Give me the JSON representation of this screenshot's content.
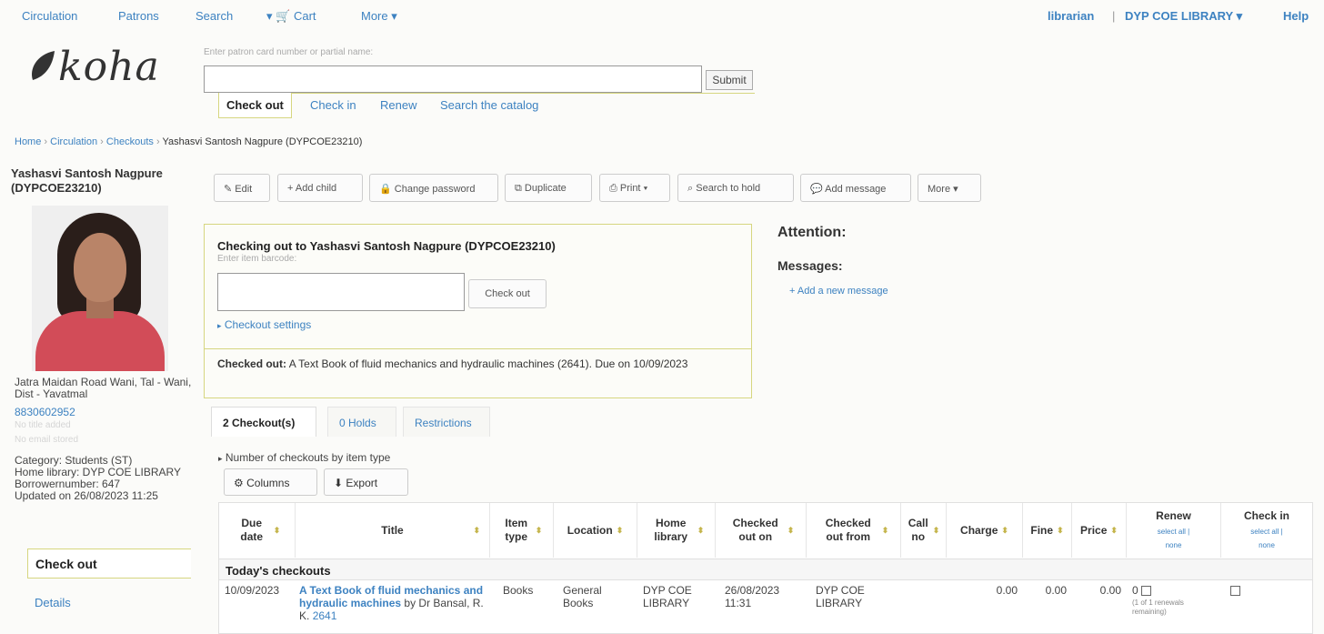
{
  "nav": {
    "circulation": "Circulation",
    "patrons": "Patrons",
    "search": "Search",
    "cart": "Cart",
    "more": "More",
    "user": "librarian",
    "separator": "|",
    "library": "DYP COE LIBRARY",
    "help": "Help"
  },
  "logo": {
    "text": "koha"
  },
  "header": {
    "hint": "Enter patron card number or partial name:",
    "patron_value": "",
    "submit": "Submit",
    "tabs": [
      "Check out",
      "Check in",
      "Renew",
      "Search the catalog"
    ]
  },
  "breadcrumb": {
    "home": "Home",
    "circulation": "Circulation",
    "checkouts": "Checkouts",
    "current": "Yashasvi Santosh Nagpure (DYPCOE23210)",
    "sep": "›"
  },
  "patron": {
    "name": "Yashasvi Santosh Nagpure",
    "cardnumber": "(DYPCOE23210)",
    "address": "Jatra Maidan Road Wani, Tal - Wani, Dist - Yavatmal",
    "phone": "8830602952",
    "faint1": "No title added",
    "faint2": "No email stored",
    "category": "Category: Students (ST)",
    "home_library": "Home library: DYP COE LIBRARY",
    "borrowernumber": "Borrowernumber: 647",
    "updated": "Updated on 26/08/2023 11:25"
  },
  "sidebar": {
    "checkout": "Check out",
    "details": "Details"
  },
  "toolbar": {
    "edit": "Edit",
    "add_child": "Add child",
    "change_password": "Change password",
    "duplicate": "Duplicate",
    "print": "Print",
    "search_to_hold": "Search to hold",
    "add_message": "Add message",
    "more": "More"
  },
  "checkout": {
    "title": "Checking out to Yashasvi Santosh Nagpure (DYPCOE23210)",
    "hint": "Enter item barcode:",
    "barcode_value": "",
    "button": "Check out",
    "settings": "Checkout settings",
    "result_label": "Checked out:",
    "result_text": "A Text Book of fluid mechanics and hydraulic machines (2641). Due on 10/09/2023"
  },
  "attention": {
    "title": "Attention:",
    "messages": "Messages:",
    "add_message": "Add a new message"
  },
  "tabs": [
    "2 Checkout(s)",
    "0 Holds",
    "Restrictions"
  ],
  "table_tools": {
    "by_type": "Number of checkouts by item type",
    "columns": "Columns",
    "export": "Export"
  },
  "table": {
    "headers": [
      "Due date",
      "Title",
      "Item type",
      "Location",
      "Home library",
      "Checked out on",
      "Checked out from",
      "Call no",
      "Charge",
      "Fine",
      "Price",
      "Renew",
      "Check in"
    ],
    "select_all": "select all |",
    "none": "none",
    "section": "Today's checkouts",
    "rows": [
      {
        "due_date": "10/09/2023",
        "title": "A Text Book of fluid mechanics and hydraulic machines",
        "by": "by Dr Bansal, R. K.",
        "barcode": "2641",
        "item_type": "Books",
        "location": "General Books",
        "home_library": "DYP COE LIBRARY",
        "checked_out_on": "26/08/2023 11:31",
        "checked_out_from": "DYP COE LIBRARY",
        "call_no": "",
        "charge": "0.00",
        "fine": "0.00",
        "price": "0.00",
        "renew_count": "0",
        "renew_note": "(1 of 1 renewals remaining)"
      }
    ]
  },
  "colors": {
    "link": "#3d82c1",
    "accent_border": "#d6d680",
    "sort_icon": "#c4b44a"
  }
}
